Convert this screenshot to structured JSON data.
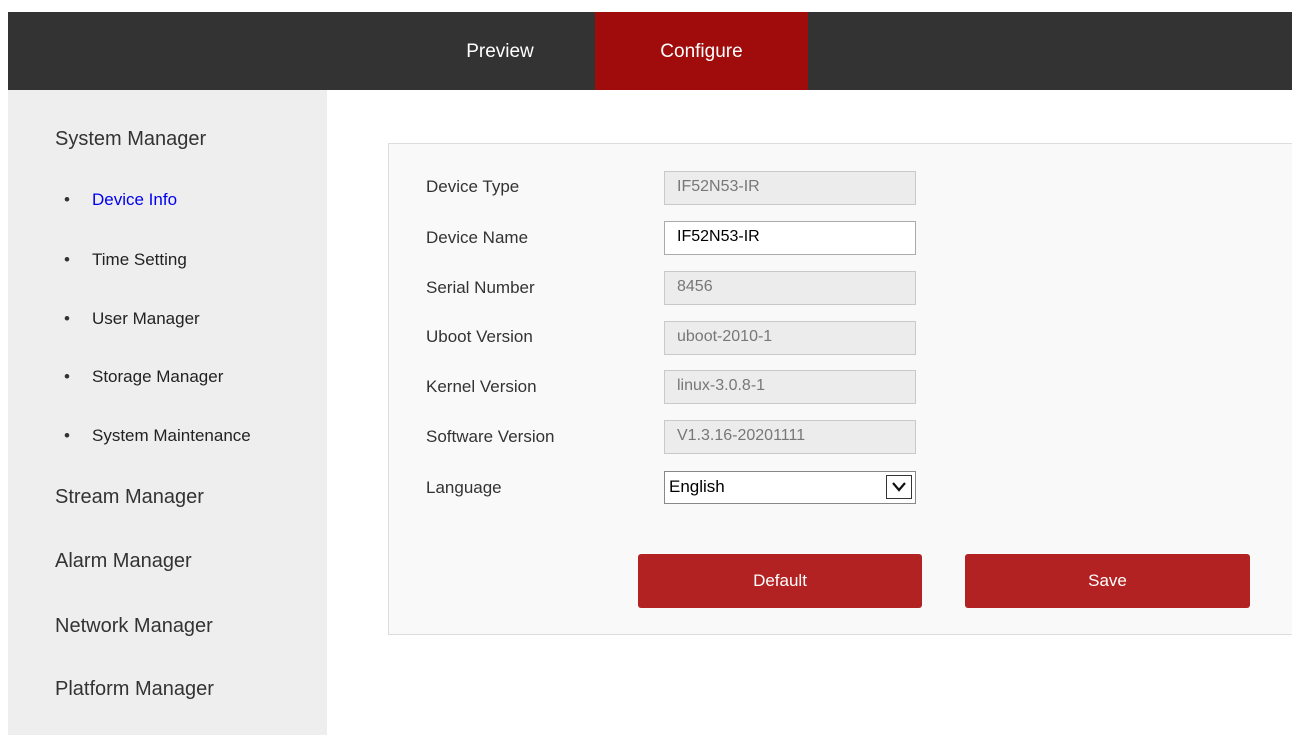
{
  "header": {
    "tabs": [
      {
        "label": "Preview",
        "active": false
      },
      {
        "label": "Configure",
        "active": true
      }
    ],
    "accent_color": "#a00b0b",
    "bar_color": "#333333"
  },
  "sidebar": {
    "groups": [
      {
        "label": "System Manager"
      },
      {
        "label": "Stream Manager"
      },
      {
        "label": "Alarm Manager"
      },
      {
        "label": "Network Manager"
      },
      {
        "label": "Platform Manager"
      }
    ],
    "system_items": [
      {
        "label": "Device Info",
        "active": true
      },
      {
        "label": "Time Setting"
      },
      {
        "label": "User Manager"
      },
      {
        "label": "Storage Manager"
      },
      {
        "label": "System Maintenance"
      }
    ],
    "bullet": "•"
  },
  "form": {
    "device_type": {
      "label": "Device Type",
      "value": "IF52N53-IR"
    },
    "device_name": {
      "label": "Device Name",
      "value": "IF52N53-IR"
    },
    "serial_number": {
      "label": "Serial Number",
      "value": "8456"
    },
    "uboot_version": {
      "label": "Uboot Version",
      "value": "uboot-2010-1"
    },
    "kernel_version": {
      "label": "Kernel Version",
      "value": "linux-3.0.8-1"
    },
    "software_version": {
      "label": "Software Version",
      "value": "V1.3.16-20201111"
    },
    "language": {
      "label": "Language",
      "value": "English"
    }
  },
  "buttons": {
    "default_label": "Default",
    "save_label": "Save",
    "color": "#b22222"
  }
}
